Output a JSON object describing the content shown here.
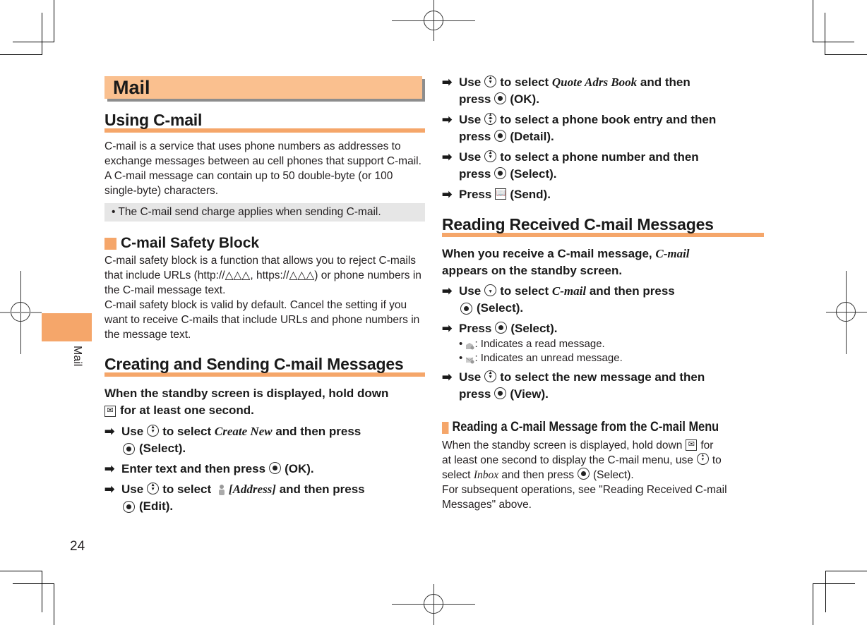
{
  "chapter": {
    "title": "Mail",
    "side_label": "Mail",
    "page_number": "24"
  },
  "using_cmail": {
    "heading": "Using C-mail",
    "body": "C-mail is a service that uses phone numbers as addresses to exchange messages between au cell phones that support C-mail. A C-mail message can contain up to 50 double-byte (or 100 single-byte) characters.",
    "note": "The C-mail send charge applies when sending C-mail."
  },
  "safety_block": {
    "heading": "C-mail Safety Block",
    "para1": "C-mail safety block is a function that allows you to reject C-mails that include URLs (http://△△△, https://△△△) or phone numbers in the C-mail message text.",
    "para2": "C-mail safety block is valid by default. Cancel the setting if you want to receive C-mails that include URLs and phone numbers in the message text."
  },
  "creating": {
    "heading": "Creating and Sending C-mail Messages",
    "lead_a": "When the standby screen is displayed, hold down",
    "lead_b": "for at least one second.",
    "steps": [
      {
        "pre": "Use",
        "mid": "to select",
        "italic": "Create New",
        "post": "and then press",
        "end": "(Select)."
      },
      {
        "pre": "Enter text and then press",
        "end": "(OK)."
      },
      {
        "pre": "Use",
        "mid": "to select",
        "italic": "[Address]",
        "post": "and then press",
        "end": "(Edit)."
      },
      {
        "pre": "Use",
        "mid": "to select",
        "italic": "Quote Adrs Book",
        "post": "and then",
        "line2": "press",
        "end": "(OK)."
      },
      {
        "pre": "Use",
        "mid": "to select a phone book entry and then",
        "line2": "press",
        "end": "(Detail)."
      },
      {
        "pre": "Use",
        "mid": "to select a phone number and then",
        "line2": "press",
        "end": "(Select)."
      },
      {
        "pre": "Press",
        "end": "(Send)."
      }
    ]
  },
  "reading": {
    "heading": "Reading Received C-mail Messages",
    "lead_a": "When you receive a C-mail message,",
    "lead_italic": "C-mail",
    "lead_b": "appears on the standby screen.",
    "steps": [
      {
        "pre": "Use",
        "mid": "to select",
        "italic": "C-mail",
        "post": "and then press",
        "end": "(Select)."
      },
      {
        "pre": "Press",
        "end": "(Select)."
      },
      {
        "pre": "Use",
        "mid": "to select the new message and then",
        "line2": "press",
        "end": "(View)."
      }
    ],
    "bullets": [
      ": Indicates a read message.",
      ": Indicates an unread message."
    ]
  },
  "menu_reading": {
    "heading": "Reading a C-mail Message from the C-mail Menu",
    "p1a": "When the standby screen is displayed, hold down",
    "p1b": "for",
    "p1c": "at least one second to display the C-mail menu, use",
    "p1d": "to",
    "p1e": "select",
    "p1italic": "Inbox",
    "p1f": "and then press",
    "p1g": "(Select).",
    "p2": "For subsequent operations, see \"Reading Received C-mail Messages\" above."
  },
  "icons": {
    "arrow": "➡",
    "bullet": "•"
  },
  "colors": {
    "accent": "#f5a66a",
    "chapter_bar": "#fac08f",
    "note_bg": "#e6e6e6"
  }
}
